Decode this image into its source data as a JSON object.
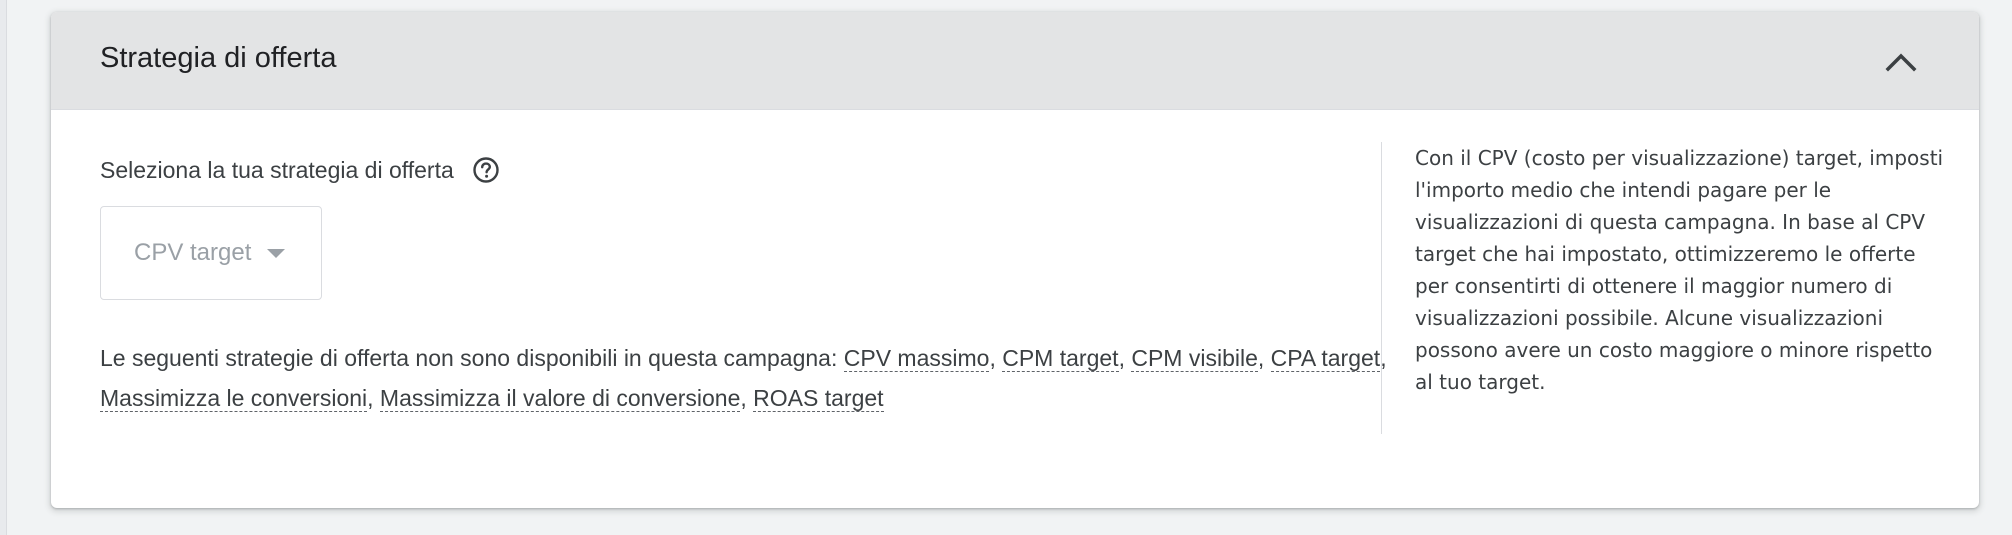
{
  "card": {
    "title": "Strategia di offerta",
    "collapse_icon": "chevron-up-icon"
  },
  "bid_strategy": {
    "prompt": "Seleziona la tua strategia di offerta",
    "help_icon": "help-circle-icon",
    "selected_value": "CPV target",
    "dropdown_icon": "caret-down-icon",
    "unavailable_intro": "Le seguenti strategie di offerta non sono disponibili in questa campagna: ",
    "unavailable": [
      "CPV massimo",
      "CPM target",
      "CPM visibile",
      "CPA target",
      "Massimizza le conversioni",
      "Massimizza il valore di conversione",
      "ROAS target"
    ],
    "separator": ", "
  },
  "info_panel": {
    "text": "Con il CPV (costo per visualizzazione) target, imposti l'importo medio che intendi pagare per le visualizzazioni di questa campagna. In base al CPV target che hai impostato, ottimizzeremo le offerte per consentirti di ottenere il maggior numero di visualizzazioni possibile. Alcune visualizzazioni possono avere un costo maggiore o minore rispetto al tuo target."
  },
  "colors": {
    "header_bg": "#e3e4e5",
    "page_bg": "#f1f3f4",
    "text": "#3c4043",
    "muted": "#9aa0a6"
  }
}
